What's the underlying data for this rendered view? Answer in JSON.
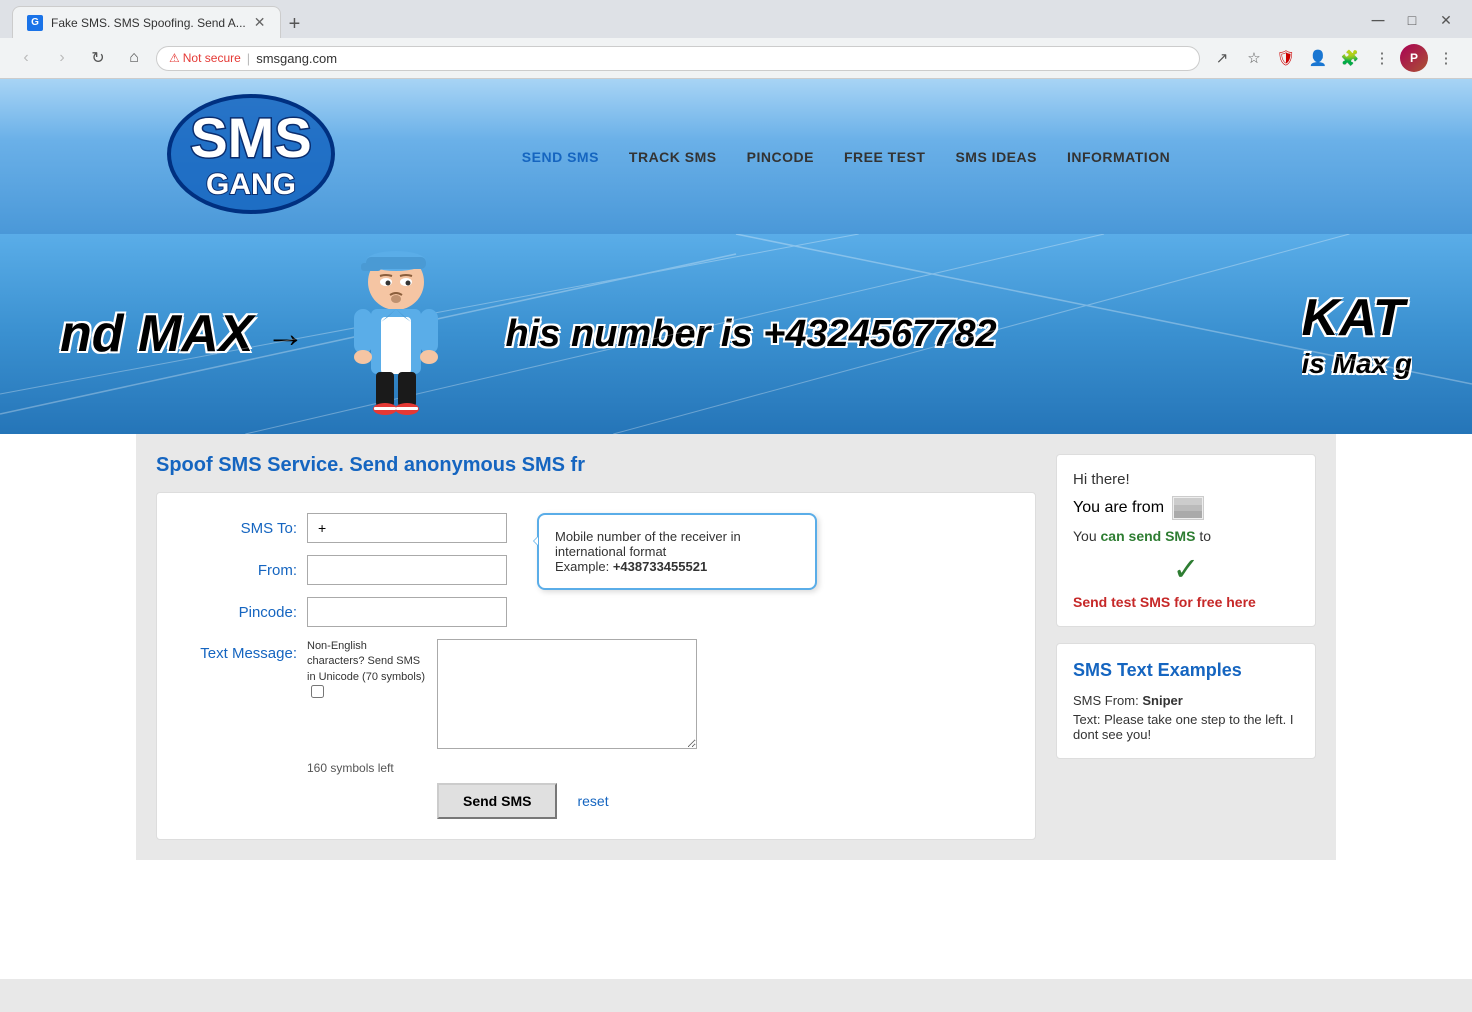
{
  "browser": {
    "tab_title": "Fake SMS. SMS Spoofing. Send A...",
    "tab_icon": "G",
    "url": "smsgang.com",
    "security_label": "Not secure",
    "new_tab_label": "+"
  },
  "site": {
    "logo_text": "SMS GANG"
  },
  "nav": {
    "items": [
      {
        "label": "SEND SMS",
        "active": true
      },
      {
        "label": "TRACK SMS",
        "active": false
      },
      {
        "label": "PINCODE",
        "active": false
      },
      {
        "label": "FREE TEST",
        "active": false
      },
      {
        "label": "SMS IDEAS",
        "active": false
      },
      {
        "label": "INFORMATION",
        "active": false
      }
    ]
  },
  "hero": {
    "text_left": "nd MAX",
    "arrow": "→",
    "center_text": "his number is +4324567782",
    "text_right": "KAT",
    "subtext_right": "is Max g"
  },
  "page": {
    "title": "Spoof SMS Service. Send anonymous SMS fr"
  },
  "form": {
    "sms_to_label": "SMS To:",
    "sms_to_placeholder": "+",
    "from_label": "From:",
    "from_placeholder": "",
    "pincode_label": "Pincode:",
    "pincode_placeholder": "",
    "text_message_label": "Text Message:",
    "text_message_placeholder": "",
    "unicode_note": "Non-English characters? Send SMS in Unicode (70 symbols)",
    "symbols_left": "160 symbols left",
    "send_btn": "Send SMS",
    "reset_link": "reset"
  },
  "tooltip": {
    "text": "Mobile number of the receiver in international format",
    "example_label": "Example:",
    "example_value": "+438733455521"
  },
  "sidebar": {
    "hi_text": "Hi there!",
    "you_are_from": "You are from",
    "can_send_text": "You",
    "can_send_green": "can send SMS",
    "can_send_suffix": "to",
    "checkmark": "✓",
    "free_link": "Send test SMS for free here",
    "examples_title": "SMS Text Examples",
    "example_from_label": "SMS From:",
    "example_from_value": "Sniper",
    "example_text_label": "Text:",
    "example_text_value": "Please take one step to the left. I dont see you!"
  }
}
